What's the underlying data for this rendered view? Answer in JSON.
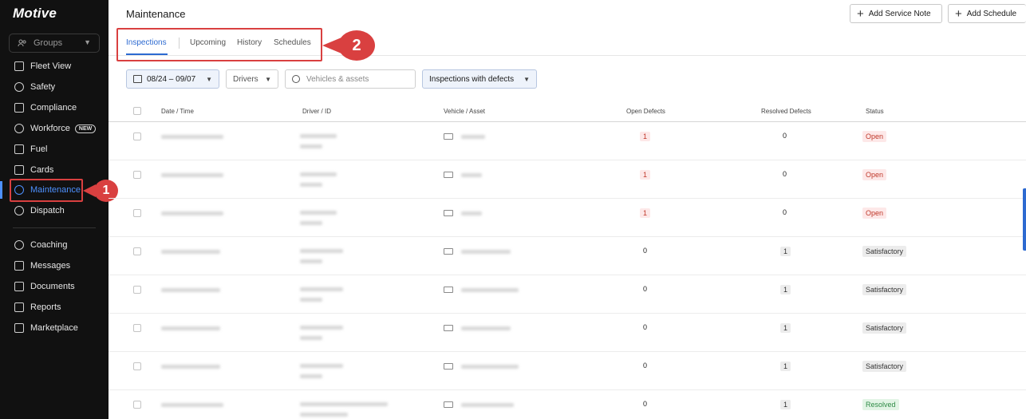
{
  "brand": "Motive",
  "sidebar": {
    "groups_label": "Groups",
    "items": [
      {
        "label": "Fleet View",
        "icon": "map-icon"
      },
      {
        "label": "Safety",
        "icon": "shield-icon"
      },
      {
        "label": "Compliance",
        "icon": "compliance-icon"
      },
      {
        "label": "Workforce",
        "icon": "user-icon",
        "badge": "NEW"
      },
      {
        "label": "Fuel",
        "icon": "fuel-icon"
      },
      {
        "label": "Cards",
        "icon": "card-icon"
      },
      {
        "label": "Maintenance",
        "icon": "wrench-icon",
        "active": true
      },
      {
        "label": "Dispatch",
        "icon": "dispatch-icon"
      },
      {
        "label": "Coaching",
        "icon": "coaching-icon"
      },
      {
        "label": "Messages",
        "icon": "messages-icon"
      },
      {
        "label": "Documents",
        "icon": "documents-icon"
      },
      {
        "label": "Reports",
        "icon": "reports-icon"
      },
      {
        "label": "Marketplace",
        "icon": "marketplace-icon"
      }
    ]
  },
  "annotations": {
    "one": "1",
    "two": "2"
  },
  "header": {
    "title": "Maintenance",
    "add_service_note": "Add Service Note",
    "add_schedule": "Add Schedule"
  },
  "tabs": [
    {
      "label": "Inspections",
      "active": true
    },
    {
      "label": "Upcoming"
    },
    {
      "label": "History"
    },
    {
      "label": "Schedules"
    }
  ],
  "filters": {
    "date_range": "08/24 – 09/07",
    "drivers": "Drivers",
    "vehicles_placeholder": "Vehicles & assets",
    "inspection_type": "Inspections with defects"
  },
  "table": {
    "columns": [
      "Date / Time",
      "Driver / ID",
      "Vehicle / Asset",
      "Open Defects",
      "Resolved Defects",
      "Status"
    ],
    "rows": [
      {
        "open": "1",
        "resolved": "0",
        "status": "Open",
        "status_type": "open"
      },
      {
        "open": "1",
        "resolved": "0",
        "status": "Open",
        "status_type": "open"
      },
      {
        "open": "1",
        "resolved": "0",
        "status": "Open",
        "status_type": "open"
      },
      {
        "open": "0",
        "resolved": "1",
        "status": "Satisfactory",
        "status_type": "sat"
      },
      {
        "open": "0",
        "resolved": "1",
        "status": "Satisfactory",
        "status_type": "sat"
      },
      {
        "open": "0",
        "resolved": "1",
        "status": "Satisfactory",
        "status_type": "sat"
      },
      {
        "open": "0",
        "resolved": "1",
        "status": "Satisfactory",
        "status_type": "sat"
      },
      {
        "open": "0",
        "resolved": "1",
        "status": "Resolved",
        "status_type": "res"
      }
    ]
  },
  "colors": {
    "accent": "#2d6ad1",
    "annotation": "#d94040",
    "sidebar_bg": "#111111"
  }
}
